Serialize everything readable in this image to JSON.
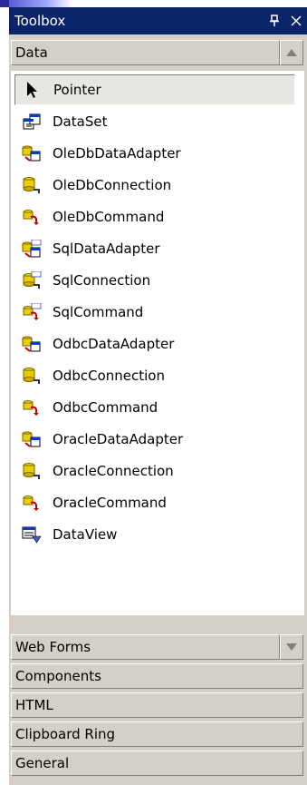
{
  "toolbox": {
    "title": "Toolbox",
    "pin_glyph": "Θ",
    "close_glyph": "×"
  },
  "tabs": {
    "data": {
      "label": "Data",
      "scroll_glyph": "up"
    },
    "web_forms": {
      "label": "Web Forms",
      "scroll_glyph": "down"
    },
    "components": {
      "label": "Components"
    },
    "html": {
      "label": "HTML"
    },
    "clipboard": {
      "label": "Clipboard Ring"
    },
    "general": {
      "label": "General"
    }
  },
  "items": [
    {
      "label": "Pointer",
      "icon": "pointer-icon",
      "selected": true
    },
    {
      "label": "DataSet",
      "icon": "dataset-icon"
    },
    {
      "label": "OleDbDataAdapter",
      "icon": "data-adapter-icon"
    },
    {
      "label": "OleDbConnection",
      "icon": "connection-icon"
    },
    {
      "label": "OleDbCommand",
      "icon": "command-icon"
    },
    {
      "label": "SqlDataAdapter",
      "icon": "sql-data-adapter-icon"
    },
    {
      "label": "SqlConnection",
      "icon": "sql-connection-icon"
    },
    {
      "label": "SqlCommand",
      "icon": "sql-command-icon"
    },
    {
      "label": "OdbcDataAdapter",
      "icon": "data-adapter-icon"
    },
    {
      "label": "OdbcConnection",
      "icon": "connection-icon"
    },
    {
      "label": "OdbcCommand",
      "icon": "command-icon"
    },
    {
      "label": "OracleDataAdapter",
      "icon": "data-adapter-icon"
    },
    {
      "label": "OracleConnection",
      "icon": "connection-icon"
    },
    {
      "label": "OracleCommand",
      "icon": "command-icon"
    },
    {
      "label": "DataView",
      "icon": "dataview-icon"
    }
  ],
  "colors": {
    "titlebar": "#0a246a",
    "panel": "#d4d0c8",
    "list_bg": "#ffffff"
  }
}
